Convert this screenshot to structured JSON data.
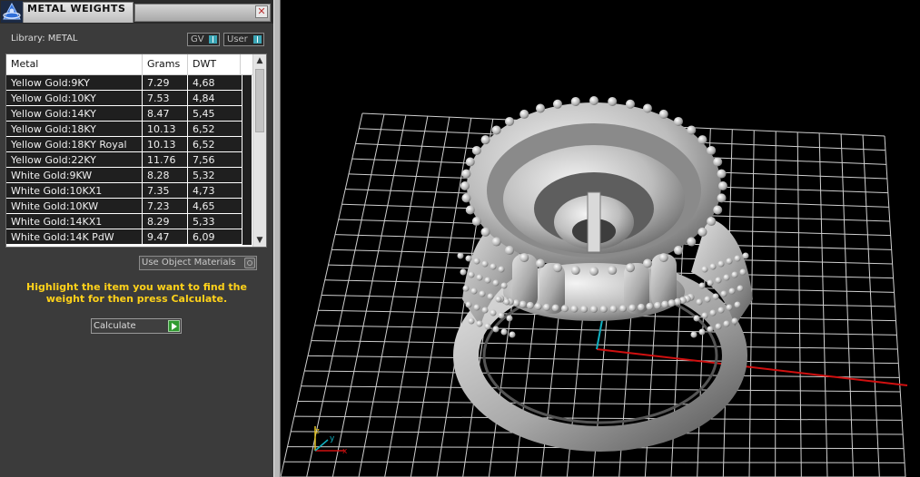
{
  "panel": {
    "title": "METAL WEIGHTS",
    "close_icon": "close-icon",
    "library_label": "Library: METAL",
    "toggle_gv": "GV",
    "toggle_user": "User",
    "columns": [
      "Metal",
      "Grams",
      "DWT"
    ],
    "rows": [
      {
        "metal": "Yellow Gold:9KY",
        "grams": "7.29",
        "dwt": "4,68"
      },
      {
        "metal": "Yellow Gold:10KY",
        "grams": "7.53",
        "dwt": "4,84"
      },
      {
        "metal": "Yellow Gold:14KY",
        "grams": "8.47",
        "dwt": "5,45"
      },
      {
        "metal": "Yellow Gold:18KY",
        "grams": "10.13",
        "dwt": "6,52"
      },
      {
        "metal": "Yellow Gold:18KY Royal",
        "grams": "10.13",
        "dwt": "6,52"
      },
      {
        "metal": "Yellow Gold:22KY",
        "grams": "11.76",
        "dwt": "7,56"
      },
      {
        "metal": "White Gold:9KW",
        "grams": "8.28",
        "dwt": "5,32"
      },
      {
        "metal": "White Gold:10KX1",
        "grams": "7.35",
        "dwt": "4,73"
      },
      {
        "metal": "White Gold:10KW",
        "grams": "7.23",
        "dwt": "4,65"
      },
      {
        "metal": "White Gold:14KX1",
        "grams": "8.29",
        "dwt": "5,33"
      },
      {
        "metal": "White Gold:14K PdW",
        "grams": "9.47",
        "dwt": "6,09"
      }
    ],
    "use_object_materials": "Use Object Materials",
    "instruction": "Highlight the item you want to find the weight for then press Calculate.",
    "calculate_label": "Calculate"
  },
  "colors": {
    "panel_bg": "#3b3b3b",
    "instruction_text": "#ffd21a",
    "row_bg": "#1f1f1f",
    "viewport_bg": "#000000",
    "grid_line": "#d8d8d8",
    "axis_x": "#d01010",
    "axis_y": "#10b0c0"
  },
  "viewport": {
    "axis_gizmo_labels": [
      "z",
      "y",
      "x"
    ]
  }
}
